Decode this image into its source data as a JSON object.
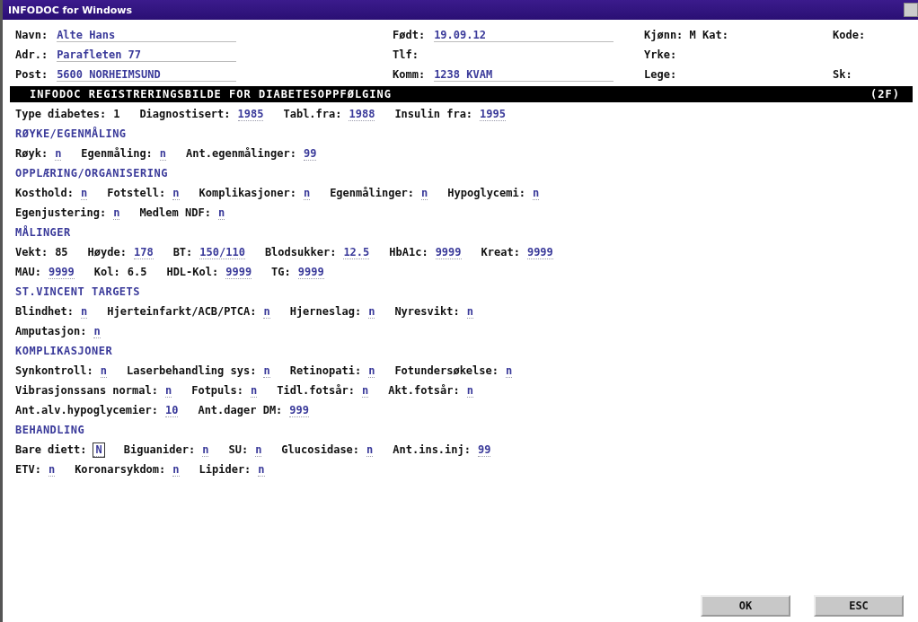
{
  "window": {
    "title": "INFODOC for Windows"
  },
  "header": {
    "rows": [
      [
        {
          "label": "Navn:",
          "value": "Alte Hans"
        },
        {
          "label": "Født:",
          "value": "19.09.12"
        },
        {
          "label": "Kjønn: M Kat:"
        },
        {
          "label": "Kode:"
        }
      ],
      [
        {
          "label": "Adr.:",
          "value": "Parafleten 77"
        },
        {
          "label": "Tlf:"
        },
        {
          "label": "Yrke:"
        },
        {}
      ],
      [
        {
          "label": "Post:",
          "value": "5600 NORHEIMSUND"
        },
        {
          "label": "Komm:",
          "value": "1238 KVAM"
        },
        {
          "label": "Lege:"
        },
        {
          "label": "Sk:"
        }
      ]
    ]
  },
  "banner": {
    "title": "INFODOC REGISTRERINGSBILDE FOR DIABETESOPPFØLGING",
    "code": "(2F)"
  },
  "lines": [
    {
      "kind": "fields",
      "fields": [
        {
          "label": "Type diabetes:",
          "value": "1",
          "kind": "plain"
        },
        {
          "label": "Diagnostisert:",
          "value": "1985",
          "kind": "entry"
        },
        {
          "label": "Tabl.fra:",
          "value": "1988",
          "kind": "entry"
        },
        {
          "label": "Insulin fra:",
          "value": "1995",
          "kind": "entry"
        }
      ]
    },
    {
      "kind": "heading",
      "text": "RØYKE/EGENMÅLING"
    },
    {
      "kind": "fields",
      "fields": [
        {
          "label": "Røyk:",
          "value": "n",
          "kind": "entry"
        },
        {
          "label": "Egenmåling:",
          "value": "n",
          "kind": "entry"
        },
        {
          "label": "Ant.egenmålinger:",
          "value": "99",
          "kind": "entry"
        }
      ]
    },
    {
      "kind": "heading",
      "text": "OPPLÆRING/ORGANISERING"
    },
    {
      "kind": "fields",
      "fields": [
        {
          "label": "Kosthold:",
          "value": "n",
          "kind": "entry"
        },
        {
          "label": "Fotstell:",
          "value": "n",
          "kind": "entry"
        },
        {
          "label": "Komplikasjoner:",
          "value": "n",
          "kind": "entry"
        },
        {
          "label": "Egenmålinger:",
          "value": "n",
          "kind": "entry"
        },
        {
          "label": "Hypoglycemi:",
          "value": "n",
          "kind": "entry"
        }
      ]
    },
    {
      "kind": "fields",
      "fields": [
        {
          "label": "Egenjustering:",
          "value": "n",
          "kind": "entry"
        },
        {
          "label": "Medlem NDF:",
          "value": "n",
          "kind": "entry"
        }
      ]
    },
    {
      "kind": "heading",
      "text": "MÅLINGER"
    },
    {
      "kind": "fields",
      "fields": [
        {
          "label": "Vekt:",
          "value": "85",
          "kind": "plain"
        },
        {
          "label": "Høyde:",
          "value": "178",
          "kind": "entry"
        },
        {
          "label": "BT:",
          "value": "150/110",
          "kind": "entry"
        },
        {
          "label": "Blodsukker:",
          "value": "12.5",
          "kind": "entry"
        },
        {
          "label": "HbA1c:",
          "value": "9999",
          "kind": "entry"
        },
        {
          "label": "Kreat:",
          "value": "9999",
          "kind": "entry"
        }
      ]
    },
    {
      "kind": "fields",
      "fields": [
        {
          "label": "MAU:",
          "value": "9999",
          "kind": "entry"
        },
        {
          "label": "Kol:",
          "value": "6.5",
          "kind": "plain"
        },
        {
          "label": "HDL-Kol:",
          "value": "9999",
          "kind": "entry"
        },
        {
          "label": "TG:",
          "value": "9999",
          "kind": "entry"
        }
      ]
    },
    {
      "kind": "heading",
      "text": "ST.VINCENT TARGETS"
    },
    {
      "kind": "fields",
      "fields": [
        {
          "label": "Blindhet:",
          "value": "n",
          "kind": "entry"
        },
        {
          "label": "Hjerteinfarkt/ACB/PTCA:",
          "value": "n",
          "kind": "entry"
        },
        {
          "label": "Hjerneslag:",
          "value": "n",
          "kind": "entry"
        },
        {
          "label": "Nyresvikt:",
          "value": "n",
          "kind": "entry"
        }
      ]
    },
    {
      "kind": "fields",
      "fields": [
        {
          "label": "Amputasjon:",
          "value": "n",
          "kind": "entry"
        }
      ]
    },
    {
      "kind": "heading",
      "text": "KOMPLIKASJONER"
    },
    {
      "kind": "fields",
      "fields": [
        {
          "label": "Synkontroll:",
          "value": "n",
          "kind": "entry"
        },
        {
          "label": "Laserbehandling sys:",
          "value": "n",
          "kind": "entry"
        },
        {
          "label": "Retinopati:",
          "value": "n",
          "kind": "entry"
        },
        {
          "label": "Fotundersøkelse:",
          "value": "n",
          "kind": "entry"
        }
      ]
    },
    {
      "kind": "fields",
      "fields": [
        {
          "label": "Vibrasjonssans normal:",
          "value": "n",
          "kind": "entry"
        },
        {
          "label": "Fotpuls:",
          "value": "n",
          "kind": "entry"
        },
        {
          "label": "Tidl.fotsår:",
          "value": "n",
          "kind": "entry"
        },
        {
          "label": "Akt.fotsår:",
          "value": "n",
          "kind": "entry"
        }
      ]
    },
    {
      "kind": "fields",
      "fields": [
        {
          "label": "Ant.alv.hypoglycemier:",
          "value": "10",
          "kind": "entry"
        },
        {
          "label": "Ant.dager DM:",
          "value": "999",
          "kind": "entry"
        }
      ]
    },
    {
      "kind": "heading",
      "text": "BEHANDLING"
    },
    {
      "kind": "fields",
      "fields": [
        {
          "label": "Bare diett:",
          "value": "N",
          "kind": "entry",
          "focused": true
        },
        {
          "label": "Biguanider:",
          "value": "n",
          "kind": "entry"
        },
        {
          "label": "SU:",
          "value": "n",
          "kind": "entry"
        },
        {
          "label": "Glucosidase:",
          "value": "n",
          "kind": "entry"
        },
        {
          "label": "Ant.ins.inj:",
          "value": "99",
          "kind": "entry"
        }
      ]
    },
    {
      "kind": "fields",
      "fields": [
        {
          "label": "ETV:",
          "value": "n",
          "kind": "entry"
        },
        {
          "label": "Koronarsykdom:",
          "value": "n",
          "kind": "entry"
        },
        {
          "label": "Lipider:",
          "value": "n",
          "kind": "entry"
        }
      ]
    }
  ],
  "buttons": [
    "OK",
    "ESC"
  ]
}
